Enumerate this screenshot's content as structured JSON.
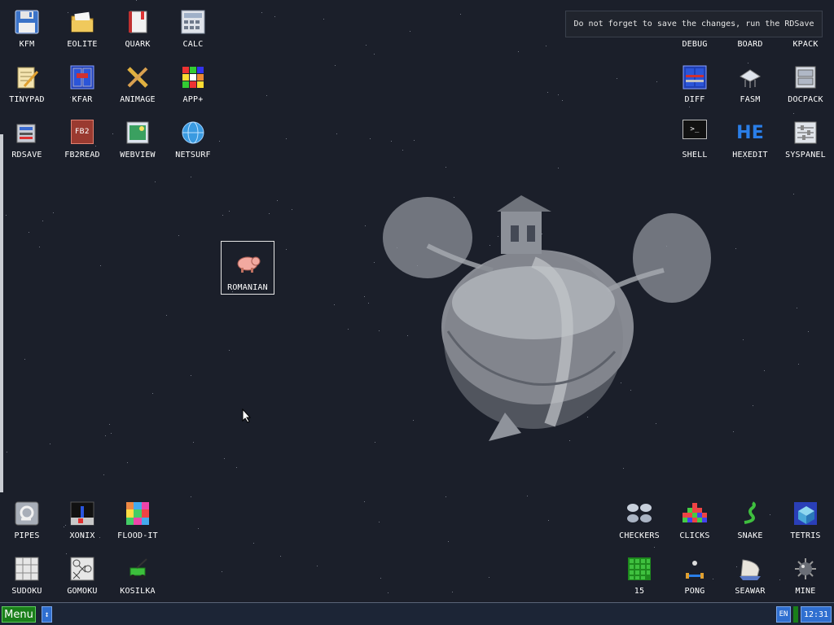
{
  "tooltip": "Do not forget to save the changes, run the RDSave",
  "desktop_icons": {
    "kfm": "KFM",
    "eolite": "EOLITE",
    "quark": "QUARK",
    "calc": "CALC",
    "tinypad": "TINYPAD",
    "kfar": "KFAR",
    "animage": "ANIMAGE",
    "appplus": "APP+",
    "rdsave": "RDSAVE",
    "fb2read": "FB2READ",
    "webview": "WEBVIEW",
    "netsurf": "NETSURF",
    "debug": "DEBUG",
    "board": "BOARD",
    "kpack": "KPACK",
    "diff": "DIFF",
    "fasm": "FASM",
    "docpack": "DOCPACK",
    "shell": "SHELL",
    "hexedit": "HEXEDIT",
    "syspanel": "SYSPANEL",
    "romanian": "ROMANIAN",
    "pipes": "PIPES",
    "xonix": "XONIX",
    "floodit": "FLOOD-IT",
    "sudoku": "SUDOKU",
    "gomoku": "GOMOKU",
    "kosilka": "KOSILKA",
    "checkers": "CHECKERS",
    "clicks": "CLICKS",
    "snake": "SNAKE",
    "tetris": "TETRIS",
    "fifteen": "15",
    "pong": "PONG",
    "seawar": "SEAWAR",
    "mine": "MINE"
  },
  "icon_glyphs": {
    "fb2read": "FB2",
    "hexedit": "HE",
    "shell": ">_"
  },
  "taskbar": {
    "menu_label": "Menu",
    "arrows_label": "↕",
    "language": "EN",
    "clock": "12:31"
  },
  "colors": {
    "background": "#1b1f2a",
    "menu_green": "#1a7f1a",
    "taskbar_blue": "#2f6fd0"
  }
}
